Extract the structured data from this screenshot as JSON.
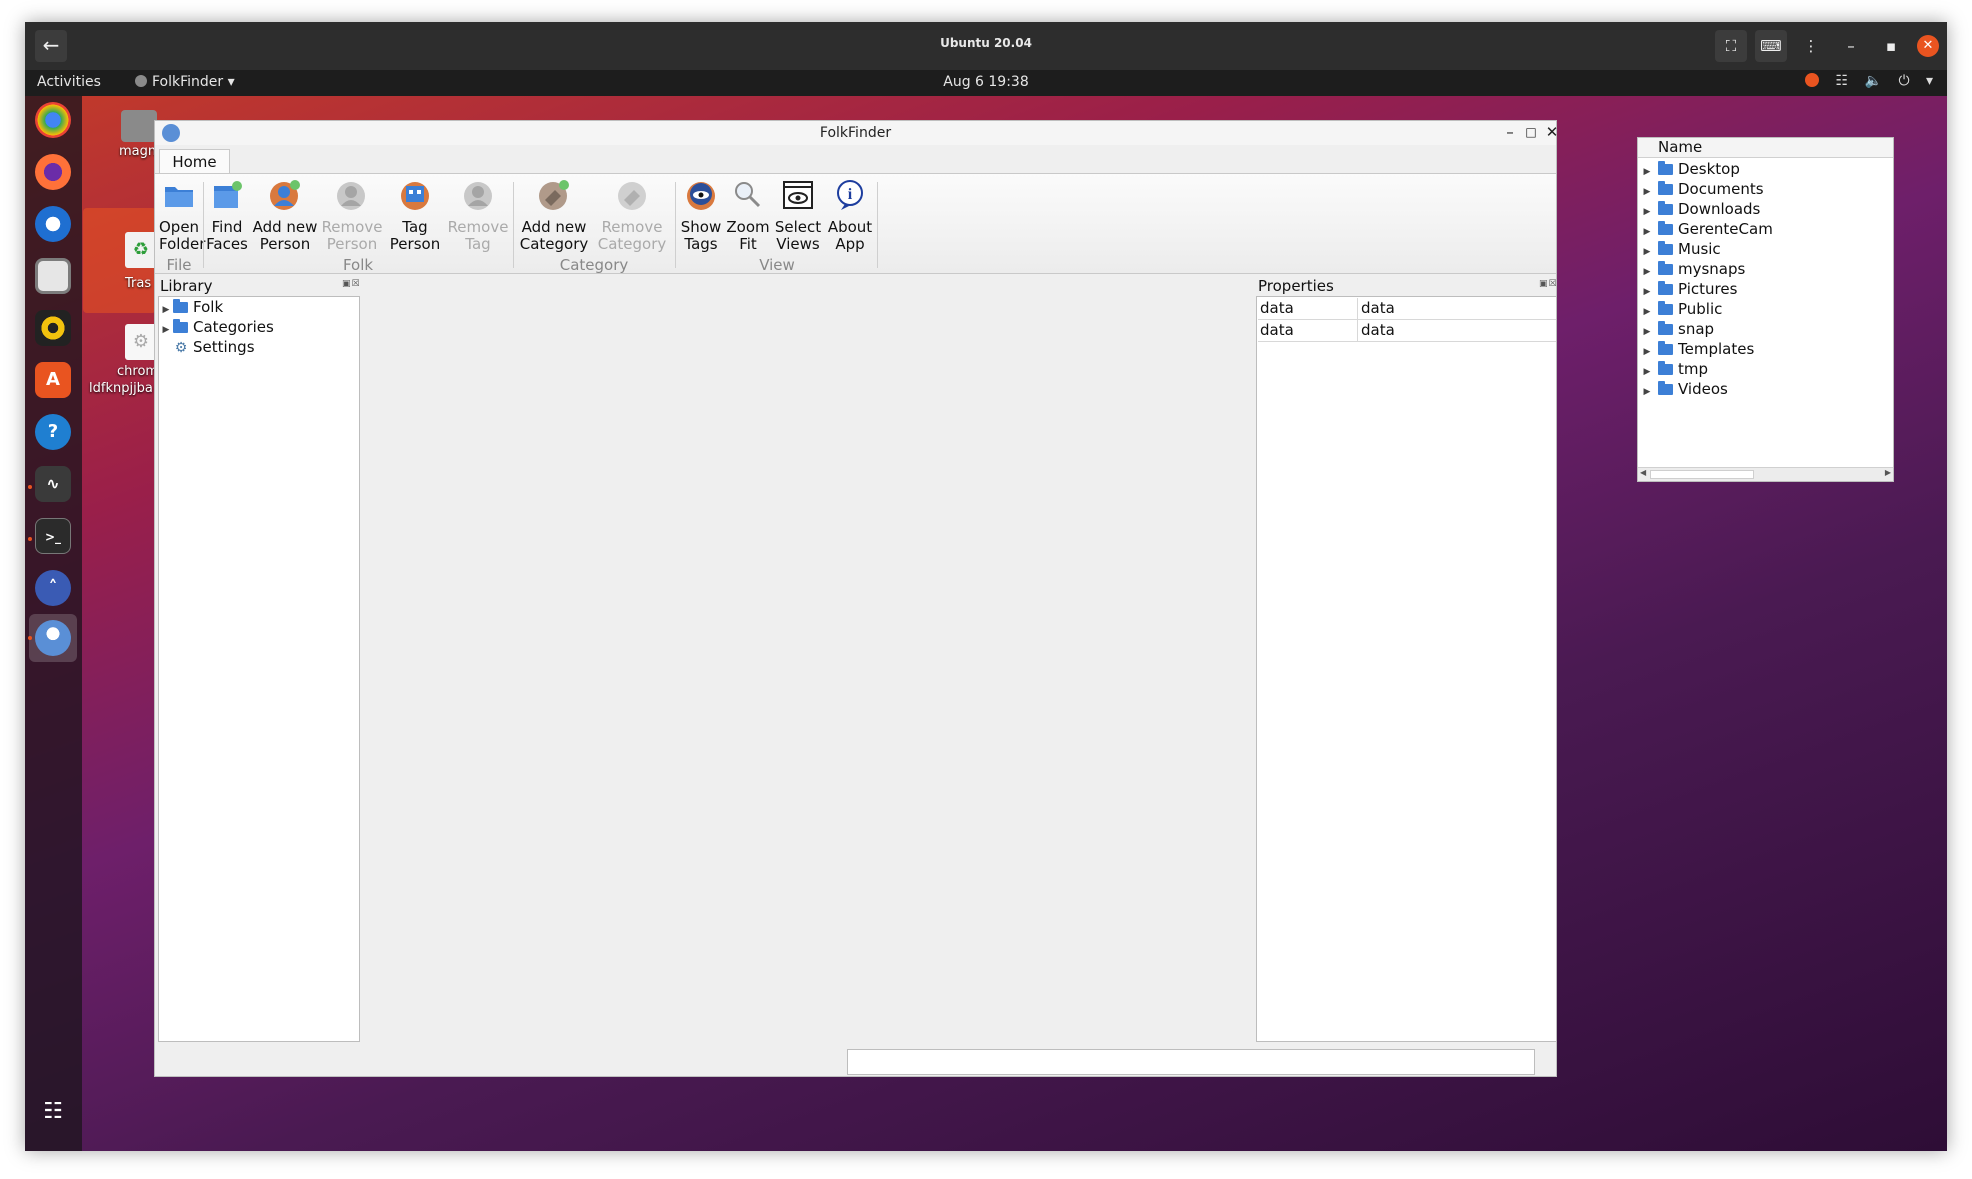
{
  "viewer": {
    "title": "Ubuntu 20.04",
    "back_icon": "arrow-left-icon",
    "buttons": [
      "fullscreen-icon",
      "keyboard-icon",
      "more-vertical-icon",
      "minimize-icon",
      "maximize-icon",
      "close-icon"
    ]
  },
  "topbar": {
    "activities": "Activities",
    "app_name": "FolkFinder",
    "clock": "Aug 6  19:38"
  },
  "desktop": {
    "icons": [
      {
        "label": "magn"
      },
      {
        "label": "Tras"
      },
      {
        "label": "chrom"
      },
      {
        "label": "ldfknpjjba"
      }
    ],
    "accent_color": "#e95420"
  },
  "dock": {
    "items": [
      "chrome-icon",
      "firefox-icon",
      "thunderbird-icon",
      "files-icon",
      "rhythmbox-icon",
      "software-icon",
      "help-icon",
      "system-monitor-icon",
      "terminal-icon",
      "app-icon",
      "folkfinder-icon",
      "show-apps-icon"
    ]
  },
  "window": {
    "title": "FolkFinder",
    "tab": "Home",
    "groups": {
      "file": "File",
      "folk": "Folk",
      "category": "Category",
      "view": "View"
    },
    "buttons": {
      "open_folder": [
        "Open",
        "Folder"
      ],
      "find_faces": [
        "Find",
        "Faces"
      ],
      "add_person": [
        "Add new",
        "Person"
      ],
      "remove_person": [
        "Remove",
        "Person"
      ],
      "tag_person": [
        "Tag",
        "Person"
      ],
      "remove_tag": [
        "Remove",
        "Tag"
      ],
      "add_category": [
        "Add new",
        "Category"
      ],
      "remove_category": [
        "Remove",
        "Category"
      ],
      "show_tags": [
        "Show",
        "Tags"
      ],
      "zoom_fit": [
        "Zoom",
        "Fit"
      ],
      "select_views": [
        "Select",
        "Views"
      ],
      "about_app": [
        "About",
        "App"
      ]
    },
    "library": {
      "title": "Library",
      "items": [
        {
          "label": "Folk",
          "expandable": true
        },
        {
          "label": "Categories",
          "expandable": true
        },
        {
          "label": "Settings",
          "expandable": false
        }
      ]
    },
    "properties": {
      "title": "Properties",
      "rows": [
        {
          "key": "data",
          "value": "data"
        },
        {
          "key": "data",
          "value": "data"
        }
      ]
    },
    "status_value": ""
  },
  "file_tree": {
    "header": "Name",
    "items": [
      "Desktop",
      "Documents",
      "Downloads",
      "GerenteCam",
      "Music",
      "mysnaps",
      "Pictures",
      "Public",
      "snap",
      "Templates",
      "tmp",
      "Videos"
    ]
  }
}
